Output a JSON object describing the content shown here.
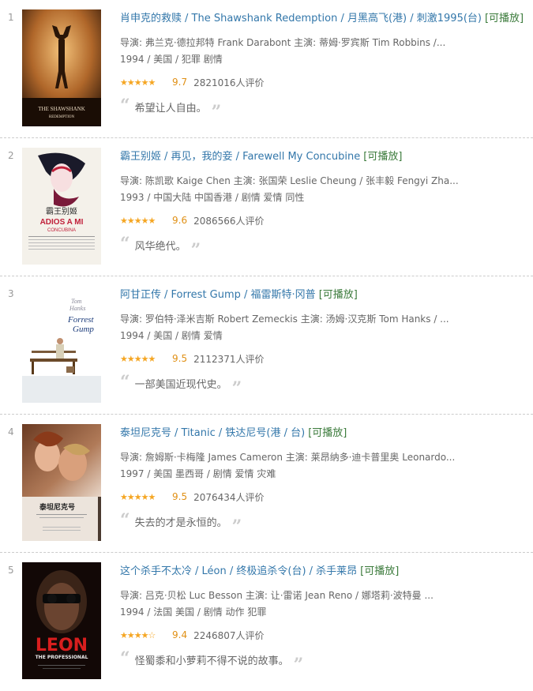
{
  "colors": {
    "link": "#3377aa",
    "playable": "#3a7a3a",
    "star": "#f5a623",
    "score": "#e09015"
  },
  "movies": [
    {
      "rank": "1",
      "title_main": "肖申克的救赎",
      "title_other": "/ The Shawshank Redemption / 月黑高飞(港) / 刺激1995(台)",
      "playable": "[可播放]",
      "credits": "导演: 弗兰克·德拉邦特 Frank Darabont   主演: 蒂姆·罗宾斯 Tim Robbins /...",
      "year_info": "1994 / 美国 / 犯罪 剧情",
      "stars": "★★★★★",
      "rating": 9.7,
      "score": "9.7",
      "votes": "2821016人评价",
      "quote": "希望让人自由。",
      "poster_text": [
        "THE SHAWSHANK",
        "REDEMPTION"
      ]
    },
    {
      "rank": "2",
      "title_main": "霸王别姬",
      "title_other": "/ 再见，我的妾 / Farewell My Concubine",
      "playable": "[可播放]",
      "credits": "导演: 陈凯歌 Kaige Chen   主演: 张国荣 Leslie Cheung / 张丰毅 Fengyi Zha...",
      "year_info": "1993 / 中国大陆 中国香港 / 剧情 爱情 同性",
      "stars": "★★★★★",
      "rating": 9.6,
      "score": "9.6",
      "votes": "2086566人评价",
      "quote": "风华绝代。",
      "poster_text": [
        "霸王别姬",
        "ADIOS A MI",
        "CONCUBINA"
      ]
    },
    {
      "rank": "3",
      "title_main": "阿甘正传",
      "title_other": "/ Forrest Gump / 福雷斯特·冈普",
      "playable": "[可播放]",
      "credits": "导演: 罗伯特·泽米吉斯 Robert Zemeckis   主演: 汤姆·汉克斯 Tom Hanks / ...",
      "year_info": "1994 / 美国 / 剧情 爱情",
      "stars": "★★★★★",
      "rating": 9.5,
      "score": "9.5",
      "votes": "2112371人评价",
      "quote": "一部美国近现代史。",
      "poster_text": [
        "Tom",
        "Hanks",
        "Forrest",
        "Gump"
      ]
    },
    {
      "rank": "4",
      "title_main": "泰坦尼克号",
      "title_other": "/ Titanic / 铁达尼号(港 / 台)",
      "playable": "[可播放]",
      "credits": "导演: 詹姆斯·卡梅隆 James Cameron   主演: 莱昂纳多·迪卡普里奥 Leonardo...",
      "year_info": "1997 / 美国 墨西哥 / 剧情 爱情 灾难",
      "stars": "★★★★★",
      "rating": 9.5,
      "score": "9.5",
      "votes": "2076434人评价",
      "quote": "失去的才是永恒的。",
      "poster_text": [
        "泰坦尼克号"
      ]
    },
    {
      "rank": "5",
      "title_main": "这个杀手不太冷",
      "title_other": "/ Léon / 终极追杀令(台) / 杀手莱昂",
      "playable": "[可播放]",
      "credits": "导演: 吕克·贝松 Luc Besson   主演: 让·雷诺 Jean Reno / 娜塔莉·波特曼 ...",
      "year_info": "1994 / 法国 美国 / 剧情 动作 犯罪",
      "stars": "★★★★☆",
      "rating": 9.4,
      "score": "9.4",
      "votes": "2246807人评价",
      "quote": "怪蜀黍和小萝莉不得不说的故事。",
      "poster_text": [
        "LEON",
        "THE PROFESSIONAL"
      ]
    }
  ]
}
